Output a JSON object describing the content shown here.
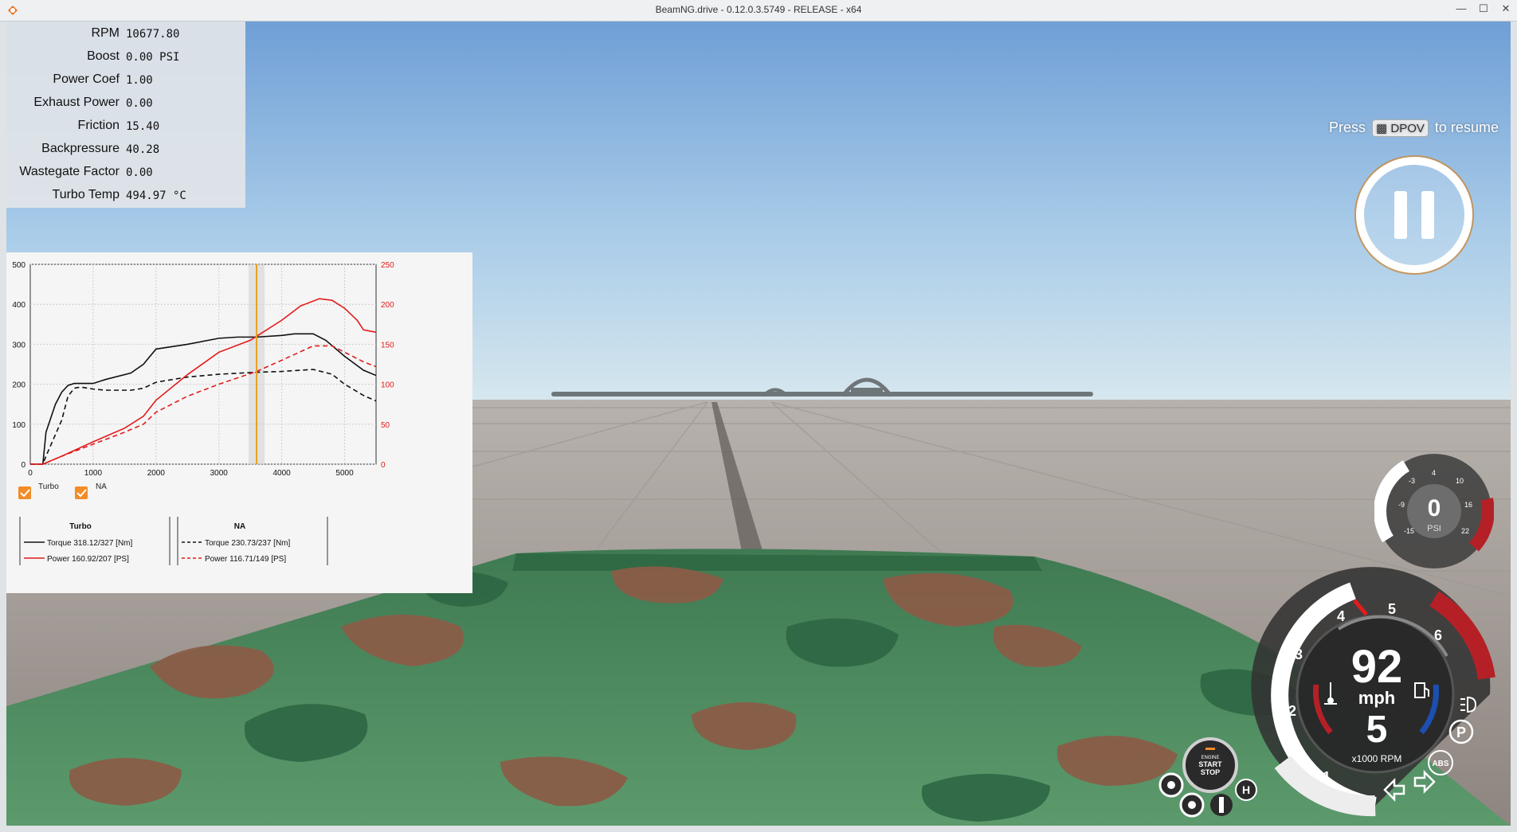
{
  "window": {
    "title": "BeamNG.drive - 0.12.0.3.5749 - RELEASE - x64",
    "controls": [
      "—",
      "☐",
      "✕"
    ]
  },
  "debug": [
    {
      "label": "RPM",
      "value": "10677.80"
    },
    {
      "label": "Boost",
      "value": "0.00 PSI"
    },
    {
      "label": "Power Coef",
      "value": "1.00"
    },
    {
      "label": "Exhaust Power",
      "value": "0.00"
    },
    {
      "label": "Friction",
      "value": "15.40"
    },
    {
      "label": "Backpressure",
      "value": "40.28"
    },
    {
      "label": "Wastegate Factor",
      "value": "0.00"
    },
    {
      "label": "Turbo Temp",
      "value": "494.97 °C"
    }
  ],
  "chart_data": {
    "type": "line",
    "x_ticks": [
      1000,
      2000,
      3000,
      4000,
      5000
    ],
    "y_left_ticks": [
      0,
      100,
      200,
      300,
      400,
      500
    ],
    "y_right_ticks": [
      0,
      50,
      100,
      150,
      200,
      250
    ],
    "xlim": [
      0,
      5500
    ],
    "ylim_left": [
      0,
      500
    ],
    "ylim_right": [
      0,
      250
    ],
    "cursor_rpm": 3600,
    "colors": {
      "torque": "#111111",
      "power": "#e21b1b",
      "cursor": "#e8a020"
    },
    "series": [
      {
        "name": "Turbo Torque",
        "axis": "left",
        "dash": false,
        "color": "#111111",
        "x": [
          0,
          200,
          250,
          400,
          500,
          600,
          700,
          800,
          1000,
          1200,
          1600,
          1800,
          2000,
          2500,
          3000,
          3300,
          3600,
          4000,
          4200,
          4500,
          4700,
          5000,
          5300,
          5500
        ],
        "y": [
          0,
          0,
          80,
          150,
          180,
          197,
          202,
          202,
          202,
          212,
          228,
          250,
          288,
          300,
          315,
          318,
          318,
          322,
          326,
          326,
          310,
          270,
          235,
          222
        ]
      },
      {
        "name": "NA Torque",
        "axis": "left",
        "dash": true,
        "color": "#111111",
        "x": [
          0,
          200,
          250,
          500,
          600,
          700,
          800,
          1000,
          1200,
          1600,
          1800,
          2000,
          2500,
          3000,
          3600,
          4000,
          4500,
          4800,
          5000,
          5300,
          5500
        ],
        "y": [
          0,
          0,
          20,
          110,
          170,
          190,
          193,
          188,
          185,
          185,
          190,
          205,
          218,
          225,
          230,
          232,
          237,
          225,
          200,
          172,
          158
        ]
      },
      {
        "name": "Turbo Power",
        "axis": "right",
        "dash": false,
        "color": "#e21b1b",
        "x": [
          0,
          200,
          500,
          1000,
          1500,
          1800,
          2000,
          2500,
          3000,
          3500,
          3600,
          4000,
          4300,
          4600,
          4800,
          5000,
          5200,
          5300,
          5500
        ],
        "y": [
          0,
          0,
          10,
          28,
          45,
          60,
          80,
          112,
          140,
          155,
          160,
          180,
          198,
          207,
          205,
          195,
          180,
          168,
          165
        ]
      },
      {
        "name": "NA Power",
        "axis": "right",
        "dash": true,
        "color": "#e21b1b",
        "x": [
          0,
          200,
          500,
          1000,
          1500,
          1800,
          2000,
          2500,
          3000,
          3600,
          4000,
          4500,
          4800,
          5000,
          5300,
          5500
        ],
        "y": [
          0,
          0,
          10,
          25,
          40,
          50,
          65,
          85,
          100,
          116,
          130,
          148,
          148,
          140,
          128,
          122
        ]
      }
    ],
    "legend": {
      "toggles": [
        "Turbo",
        "NA"
      ],
      "turbo": {
        "title": "Turbo",
        "torque": "Torque 318.12/327 [Nm]",
        "power": "Power 160.92/207 [PS]"
      },
      "na": {
        "title": "NA",
        "torque": "Torque 230.73/237 [Nm]",
        "power": "Power 116.71/149 [PS]"
      }
    }
  },
  "pause": {
    "press": "Press",
    "key": "DPOV",
    "suffix": "to resume"
  },
  "boost_gauge": {
    "value": "0",
    "unit": "PSI",
    "ticks": [
      "-3",
      "4",
      "10",
      "-9",
      "16",
      "-15",
      "22"
    ]
  },
  "dash": {
    "speed": "92",
    "speed_unit": "mph",
    "gear": "5",
    "rpm_unit": "x1000 RPM",
    "rpm_ticks": [
      "1",
      "2",
      "3",
      "4",
      "5",
      "6"
    ],
    "parking": "P",
    "abs": "ABS",
    "start_top": "ENGINE",
    "start": "START",
    "stop": "STOP",
    "h_label": "H"
  },
  "colors": {
    "sky_top": "#6f9fd6",
    "sky_horizon": "#cfe4ef",
    "ground": "#9a928c",
    "camo_green": "#4e8a60",
    "camo_brown": "#8a5d48",
    "redline": "#b52027"
  }
}
